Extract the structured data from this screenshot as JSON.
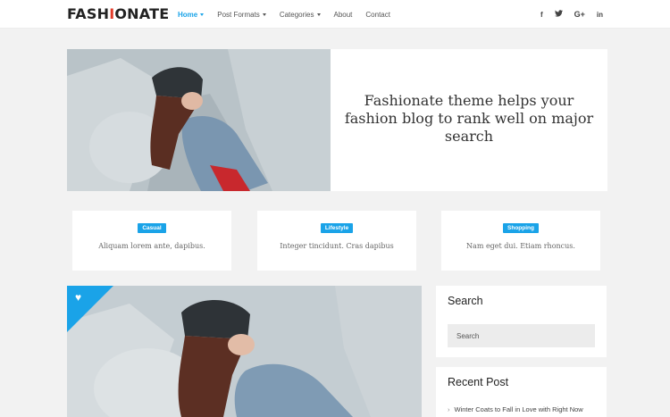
{
  "header": {
    "logo_left": "FASH",
    "logo_accent": "I",
    "logo_right": "ONATE",
    "nav": [
      {
        "label": "Home",
        "active": true,
        "dropdown": true
      },
      {
        "label": "Post Formats",
        "active": false,
        "dropdown": true
      },
      {
        "label": "Categories",
        "active": false,
        "dropdown": true
      },
      {
        "label": "About",
        "active": false,
        "dropdown": false
      },
      {
        "label": "Contact",
        "active": false,
        "dropdown": false
      }
    ],
    "social": {
      "facebook": "f",
      "twitter": "t",
      "gplus": "G+",
      "linkedin": "in"
    }
  },
  "hero": {
    "title": "Fashionate theme helps your fashion blog to rank well on major search"
  },
  "categories": [
    {
      "tag": "Casual",
      "text": "Aliquam lorem ante, dapibus."
    },
    {
      "tag": "Lifestyle",
      "text": "Integer tincidunt. Cras dapibus"
    },
    {
      "tag": "Shopping",
      "text": "Nam eget dui. Etiam rhoncus."
    }
  ],
  "sidebar": {
    "search_title": "Search",
    "search_placeholder": "Search",
    "recent_title": "Recent Post",
    "recent_items": [
      "Winter Coats to Fall in Love with Right Now"
    ]
  },
  "colors": {
    "accent": "#1aa3e8",
    "logo_accent": "#e23c2b"
  }
}
